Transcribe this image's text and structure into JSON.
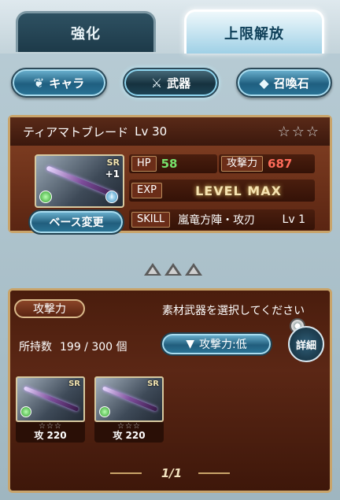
{
  "tabs": [
    {
      "label": "強化",
      "active": false
    },
    {
      "label": "上限解放",
      "active": true
    }
  ],
  "categories": [
    {
      "label": "キャラ",
      "icon": "wings-icon",
      "selected": false
    },
    {
      "label": "武器",
      "icon": "crossed-swords-icon",
      "selected": true
    },
    {
      "label": "召喚石",
      "icon": "crystal-icon",
      "selected": false
    }
  ],
  "base_weapon": {
    "name": "ティアマトブレード",
    "level_label": "Lv 30",
    "stars": "☆☆☆",
    "rarity": "SR",
    "plus": "+1",
    "hp_label": "HP",
    "hp": "58",
    "atk_label": "攻撃力",
    "atk": "687",
    "exp_label": "EXP",
    "exp_status": "LEVEL MAX",
    "skill_label": "SKILL",
    "skill_name": "嵐竜方陣・攻刃",
    "skill_level": "Lv 1",
    "change_base_label": "ベース変更",
    "skill_badge": "i"
  },
  "materials": {
    "sort_tag": "攻撃力",
    "message": "素材武器を選択してください",
    "owned_label": "所持数",
    "owned_count": "199 / 300 個",
    "sort_button": "攻撃力:低",
    "detail_button": "詳細",
    "page": "1/1",
    "items": [
      {
        "rarity": "SR",
        "stars": "☆☆☆",
        "atk": "攻 220"
      },
      {
        "rarity": "SR",
        "stars": "☆☆☆",
        "atk": "攻 220"
      }
    ]
  },
  "colors": {
    "panel_border": "#c9a46a",
    "hp_value": "#77e26b",
    "atk_value": "#ff6b5a"
  }
}
